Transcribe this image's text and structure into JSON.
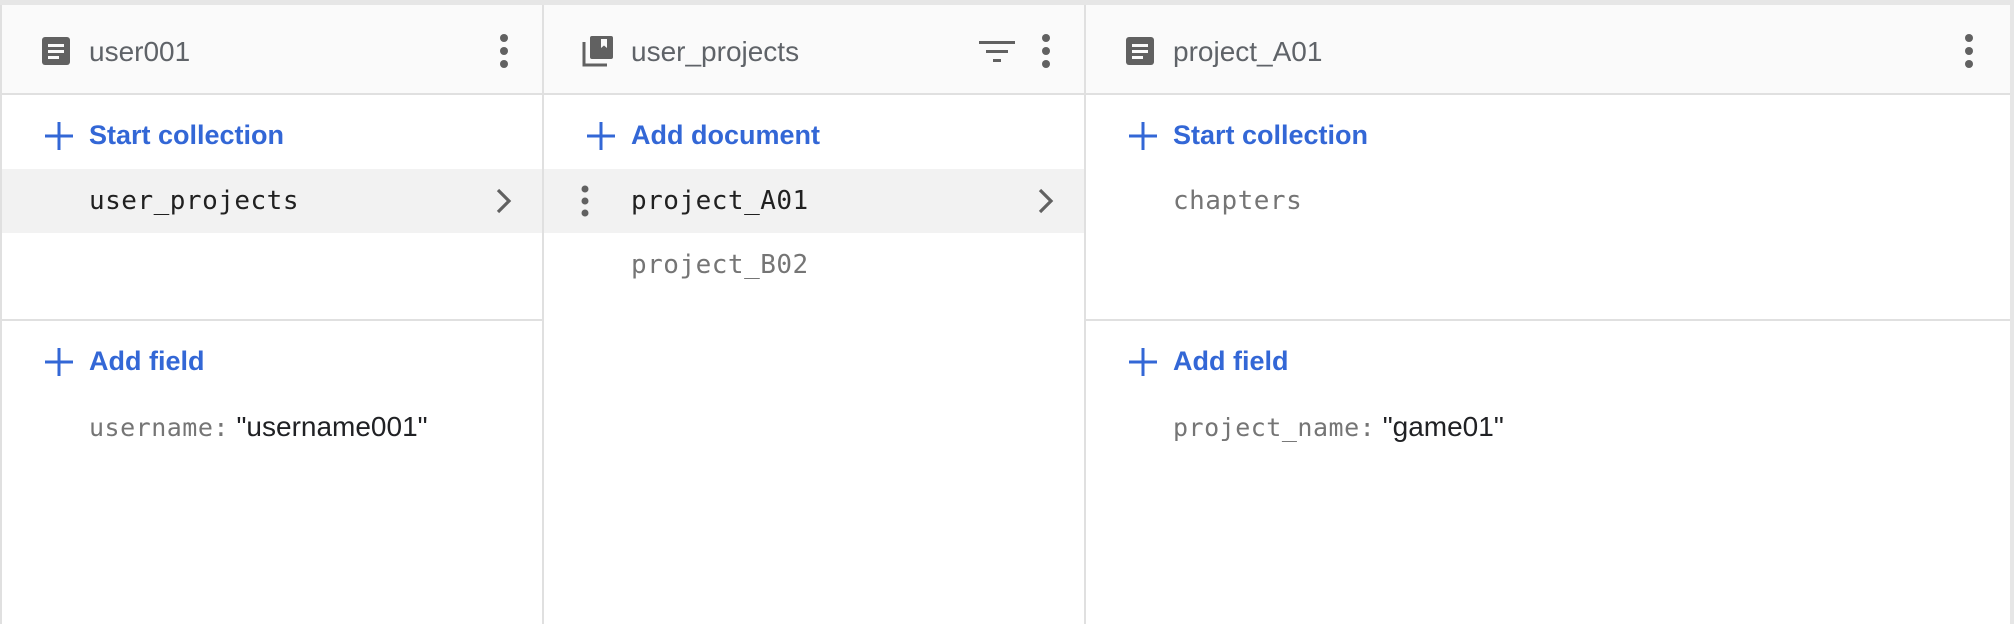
{
  "colors": {
    "accent": "#3367d6",
    "icon": "#616161",
    "header_text": "#5f6368",
    "muted_text": "#757575",
    "dark_text": "#212121",
    "selected_bg": "#f2f2f2",
    "border": "#e0e0e0"
  },
  "panels": [
    {
      "header": {
        "icon": "document-icon",
        "title": "user001"
      },
      "action": {
        "label": "Start collection"
      },
      "items": [
        {
          "label": "user_projects",
          "selected": true
        }
      ],
      "field_action": {
        "label": "Add field"
      },
      "fields": [
        {
          "key": "username:",
          "value": "\"username001\""
        }
      ]
    },
    {
      "header": {
        "icon": "collection-icon",
        "title": "user_projects"
      },
      "action": {
        "label": "Add document"
      },
      "items": [
        {
          "label": "project_A01",
          "selected": true
        },
        {
          "label": "project_B02",
          "selected": false
        }
      ]
    },
    {
      "header": {
        "icon": "document-icon",
        "title": "project_A01"
      },
      "action": {
        "label": "Start collection"
      },
      "items": [
        {
          "label": "chapters",
          "selected": false
        }
      ],
      "field_action": {
        "label": "Add field"
      },
      "fields": [
        {
          "key": "project_name:",
          "value": "\"game01\""
        }
      ]
    }
  ]
}
